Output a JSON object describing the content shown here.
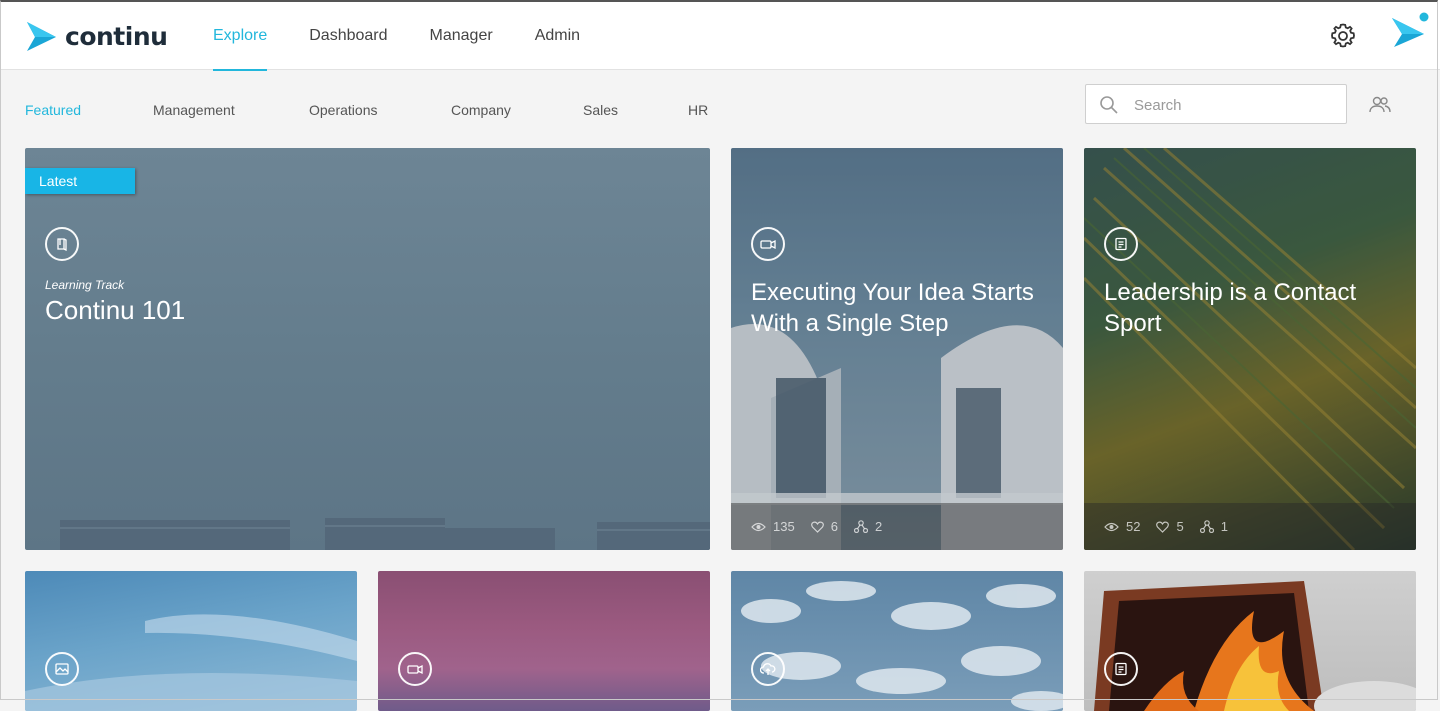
{
  "header": {
    "logo_text": "continu",
    "nav": [
      "Explore",
      "Dashboard",
      "Manager",
      "Admin"
    ],
    "active_nav": "Explore"
  },
  "subnav": {
    "items": [
      "Featured",
      "Management",
      "Operations",
      "Company",
      "Sales",
      "HR"
    ],
    "active": "Featured"
  },
  "search": {
    "placeholder": "Search"
  },
  "cards": {
    "featured": {
      "badge": "Latest",
      "kicker": "Learning Track",
      "title": "Continu 101",
      "icon": "book-icon"
    },
    "card2": {
      "title": "Executing Your Idea Starts With a Single Step",
      "icon": "video-icon",
      "views": "135",
      "likes": "6",
      "shares": "2"
    },
    "card3": {
      "title": "Leadership is a Contact Sport",
      "icon": "document-icon",
      "views": "52",
      "likes": "5",
      "shares": "1"
    },
    "card4": {
      "icon": "image-icon"
    },
    "card5": {
      "icon": "video-icon"
    },
    "card6": {
      "icon": "cloud-upload-icon"
    },
    "card7": {
      "icon": "article-icon"
    }
  },
  "colors": {
    "accent": "#22b7dc",
    "badge": "#18b5e6",
    "logo_dark": "#1f2d3a"
  }
}
